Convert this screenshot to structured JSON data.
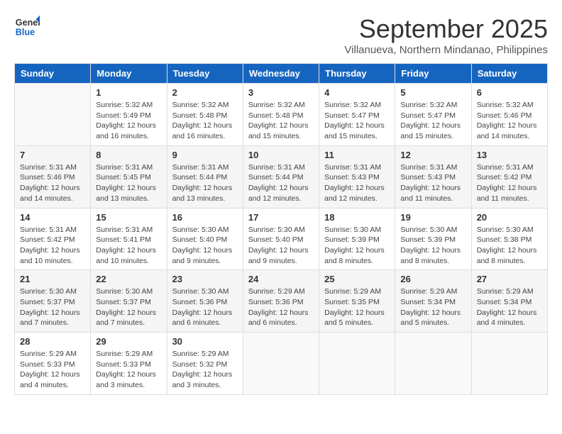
{
  "logo": {
    "line1": "General",
    "line2": "Blue"
  },
  "title": "September 2025",
  "subtitle": "Villanueva, Northern Mindanao, Philippines",
  "days_of_week": [
    "Sunday",
    "Monday",
    "Tuesday",
    "Wednesday",
    "Thursday",
    "Friday",
    "Saturday"
  ],
  "weeks": [
    [
      {
        "day": "",
        "info": ""
      },
      {
        "day": "1",
        "info": "Sunrise: 5:32 AM\nSunset: 5:49 PM\nDaylight: 12 hours\nand 16 minutes."
      },
      {
        "day": "2",
        "info": "Sunrise: 5:32 AM\nSunset: 5:48 PM\nDaylight: 12 hours\nand 16 minutes."
      },
      {
        "day": "3",
        "info": "Sunrise: 5:32 AM\nSunset: 5:48 PM\nDaylight: 12 hours\nand 15 minutes."
      },
      {
        "day": "4",
        "info": "Sunrise: 5:32 AM\nSunset: 5:47 PM\nDaylight: 12 hours\nand 15 minutes."
      },
      {
        "day": "5",
        "info": "Sunrise: 5:32 AM\nSunset: 5:47 PM\nDaylight: 12 hours\nand 15 minutes."
      },
      {
        "day": "6",
        "info": "Sunrise: 5:32 AM\nSunset: 5:46 PM\nDaylight: 12 hours\nand 14 minutes."
      }
    ],
    [
      {
        "day": "7",
        "info": "Sunrise: 5:31 AM\nSunset: 5:46 PM\nDaylight: 12 hours\nand 14 minutes."
      },
      {
        "day": "8",
        "info": "Sunrise: 5:31 AM\nSunset: 5:45 PM\nDaylight: 12 hours\nand 13 minutes."
      },
      {
        "day": "9",
        "info": "Sunrise: 5:31 AM\nSunset: 5:44 PM\nDaylight: 12 hours\nand 13 minutes."
      },
      {
        "day": "10",
        "info": "Sunrise: 5:31 AM\nSunset: 5:44 PM\nDaylight: 12 hours\nand 12 minutes."
      },
      {
        "day": "11",
        "info": "Sunrise: 5:31 AM\nSunset: 5:43 PM\nDaylight: 12 hours\nand 12 minutes."
      },
      {
        "day": "12",
        "info": "Sunrise: 5:31 AM\nSunset: 5:43 PM\nDaylight: 12 hours\nand 11 minutes."
      },
      {
        "day": "13",
        "info": "Sunrise: 5:31 AM\nSunset: 5:42 PM\nDaylight: 12 hours\nand 11 minutes."
      }
    ],
    [
      {
        "day": "14",
        "info": "Sunrise: 5:31 AM\nSunset: 5:42 PM\nDaylight: 12 hours\nand 10 minutes."
      },
      {
        "day": "15",
        "info": "Sunrise: 5:31 AM\nSunset: 5:41 PM\nDaylight: 12 hours\nand 10 minutes."
      },
      {
        "day": "16",
        "info": "Sunrise: 5:30 AM\nSunset: 5:40 PM\nDaylight: 12 hours\nand 9 minutes."
      },
      {
        "day": "17",
        "info": "Sunrise: 5:30 AM\nSunset: 5:40 PM\nDaylight: 12 hours\nand 9 minutes."
      },
      {
        "day": "18",
        "info": "Sunrise: 5:30 AM\nSunset: 5:39 PM\nDaylight: 12 hours\nand 8 minutes."
      },
      {
        "day": "19",
        "info": "Sunrise: 5:30 AM\nSunset: 5:39 PM\nDaylight: 12 hours\nand 8 minutes."
      },
      {
        "day": "20",
        "info": "Sunrise: 5:30 AM\nSunset: 5:38 PM\nDaylight: 12 hours\nand 8 minutes."
      }
    ],
    [
      {
        "day": "21",
        "info": "Sunrise: 5:30 AM\nSunset: 5:37 PM\nDaylight: 12 hours\nand 7 minutes."
      },
      {
        "day": "22",
        "info": "Sunrise: 5:30 AM\nSunset: 5:37 PM\nDaylight: 12 hours\nand 7 minutes."
      },
      {
        "day": "23",
        "info": "Sunrise: 5:30 AM\nSunset: 5:36 PM\nDaylight: 12 hours\nand 6 minutes."
      },
      {
        "day": "24",
        "info": "Sunrise: 5:29 AM\nSunset: 5:36 PM\nDaylight: 12 hours\nand 6 minutes."
      },
      {
        "day": "25",
        "info": "Sunrise: 5:29 AM\nSunset: 5:35 PM\nDaylight: 12 hours\nand 5 minutes."
      },
      {
        "day": "26",
        "info": "Sunrise: 5:29 AM\nSunset: 5:34 PM\nDaylight: 12 hours\nand 5 minutes."
      },
      {
        "day": "27",
        "info": "Sunrise: 5:29 AM\nSunset: 5:34 PM\nDaylight: 12 hours\nand 4 minutes."
      }
    ],
    [
      {
        "day": "28",
        "info": "Sunrise: 5:29 AM\nSunset: 5:33 PM\nDaylight: 12 hours\nand 4 minutes."
      },
      {
        "day": "29",
        "info": "Sunrise: 5:29 AM\nSunset: 5:33 PM\nDaylight: 12 hours\nand 3 minutes."
      },
      {
        "day": "30",
        "info": "Sunrise: 5:29 AM\nSunset: 5:32 PM\nDaylight: 12 hours\nand 3 minutes."
      },
      {
        "day": "",
        "info": ""
      },
      {
        "day": "",
        "info": ""
      },
      {
        "day": "",
        "info": ""
      },
      {
        "day": "",
        "info": ""
      }
    ]
  ]
}
